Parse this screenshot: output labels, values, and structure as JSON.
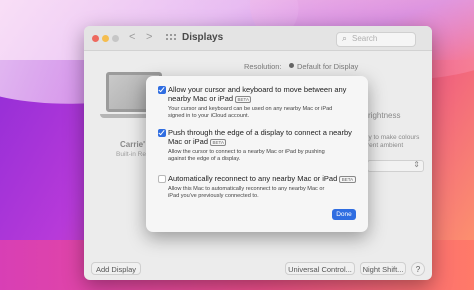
{
  "window": {
    "title": "Displays",
    "nav_back": "<",
    "nav_forward": ">",
    "search_placeholder": "Search"
  },
  "display_settings": {
    "resolution_label": "Resolution:",
    "resolution_value": "Default for Display",
    "display_name": "Carrie'",
    "display_subtitle": "Built-in Re",
    "brightness_label": "rightness",
    "ambient_text_line1": "ly to make colours",
    "ambient_text_line2": "rent ambient"
  },
  "bottom_buttons": {
    "add_display": "Add Display ⌄",
    "universal_control": "Universal Control...",
    "night_shift": "Night Shift...",
    "help": "?"
  },
  "sheet": {
    "options": [
      {
        "checked": true,
        "title_line1": "Allow your cursor and keyboard to move between any",
        "title_line2": "nearby Mac or iPad",
        "badge": "BETA",
        "description_line1": "Your cursor and keyboard can be used on any nearby Mac or iPad",
        "description_line2": "signed in to your iCloud account."
      },
      {
        "checked": true,
        "title_line1": "Push through the edge of a display to connect a nearby",
        "title_line2": "Mac or iPad",
        "badge": "BETA",
        "description_line1": "Allow the cursor to connect to a nearby Mac or iPad by pushing",
        "description_line2": "against the edge of a display."
      },
      {
        "checked": false,
        "title_line1": "Automatically reconnect to any nearby Mac or iPad",
        "badge": "BETA",
        "description_line1": "Allow this Mac to automatically reconnect to any nearby Mac or",
        "description_line2": "iPad you've previously connected to."
      }
    ],
    "done_label": "Done"
  },
  "colors": {
    "accent": "#2f6de1",
    "close_light": "#ee6a5f",
    "minimize_light": "#f5bd4f"
  }
}
